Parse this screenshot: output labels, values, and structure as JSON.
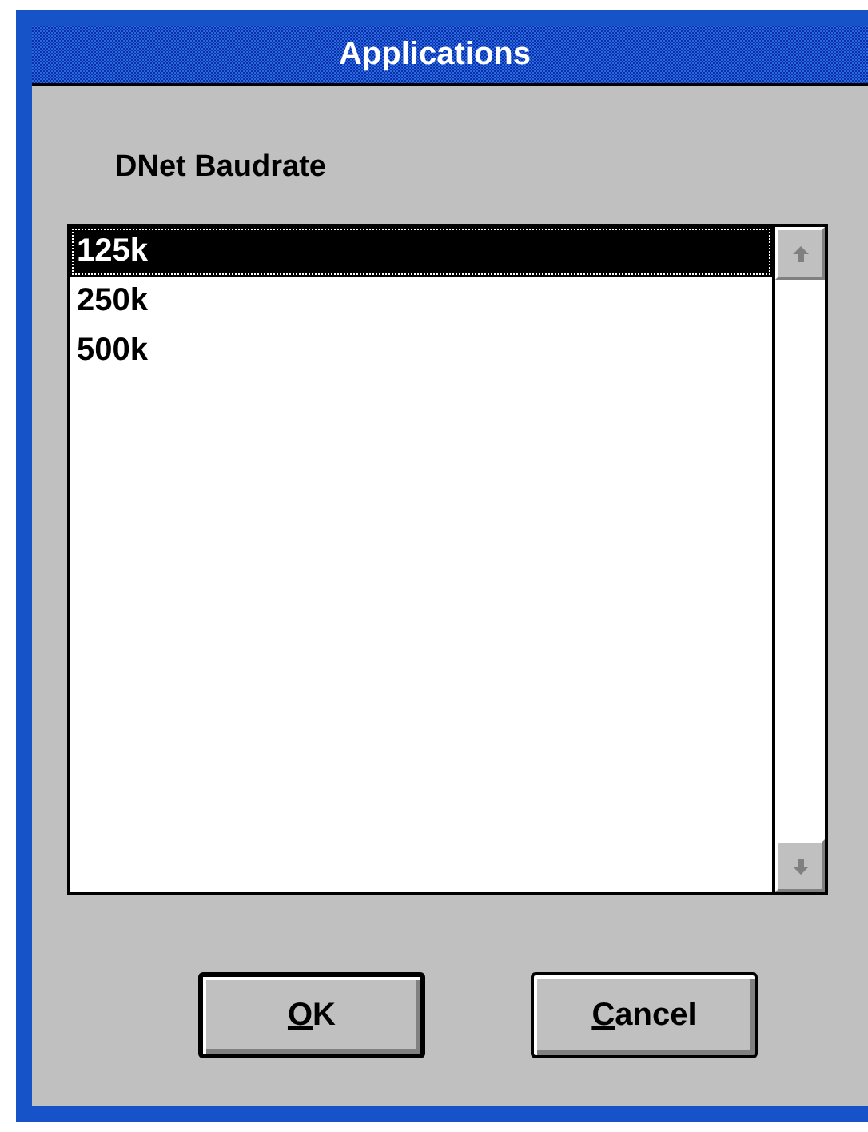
{
  "window": {
    "title": "Applications"
  },
  "label": "DNet Baudrate",
  "list": {
    "items": [
      {
        "text": "125k",
        "selected": true
      },
      {
        "text": "250k",
        "selected": false
      },
      {
        "text": "500k",
        "selected": false
      }
    ]
  },
  "buttons": [
    {
      "mnemonic": "O",
      "rest": "K",
      "default": true
    },
    {
      "mnemonic": "C",
      "rest": "ancel",
      "default": false
    }
  ]
}
